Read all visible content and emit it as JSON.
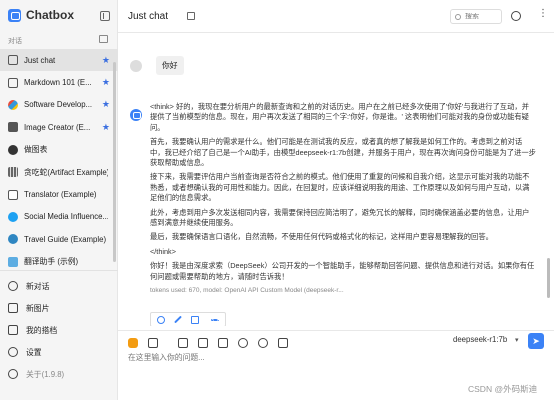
{
  "app": {
    "name": "Chatbox",
    "version_label": "关于(1.9.8)"
  },
  "sidebar": {
    "section_label": "对话",
    "items": [
      {
        "label": "Just chat",
        "icon": "chat-icon",
        "active": true,
        "starred": true
      },
      {
        "label": "Markdown 101 (E...",
        "icon": "chat-icon",
        "starred": true
      },
      {
        "label": "Software Develop...",
        "icon": "developer-avatar",
        "starred": true
      },
      {
        "label": "Image Creator (E...",
        "icon": "image-icon",
        "starred": true
      },
      {
        "label": "做图表",
        "icon": "chart-avatar",
        "starred": false
      },
      {
        "label": "贪吃蛇(Artifact Example)",
        "icon": "grid-avatar",
        "starred": false
      },
      {
        "label": "Translator (Example)",
        "icon": "translate-icon",
        "starred": false
      },
      {
        "label": "Social Media Influence...",
        "icon": "twitter-icon",
        "starred": false
      },
      {
        "label": "Travel Guide (Example)",
        "icon": "globe-avatar",
        "starred": false
      },
      {
        "label": "翻译助手 (示例)",
        "icon": "translate-avatar",
        "starred": false
      }
    ],
    "bottom": {
      "new_chat": "新对话",
      "new_image": "新图片",
      "my_partners": "我的搭档",
      "settings": "设置"
    }
  },
  "header": {
    "title": "Just chat",
    "search_placeholder": "搜索"
  },
  "conversation": {
    "user_message": "你好",
    "bot_paragraphs": [
      "<think> 好的，我现在要分析用户的最新查询和之前的对话历史。用户在之前已经多次使用了'你好'与我进行了互动，并提供了当前模型的信息。现在，用户再次发送了相同的三个字:'你好，你是谁。' 这表明他们可能对我的身份或功能有疑问。",
      "首先，我要确认用户的需求是什么。他们可能是在测试我的反应，或者真的想了解我是如何工作的。考虑到之前对话中，我已经介绍了自己是一个AI助手，由模型deepseek-r1:7b创建，并服务于用户，现在再次询问身份可能是为了进一步获取帮助或信息。",
      "接下来，我需要评估用户当前查询是否符合之前的模式。他们使用了重复的问候和自我介绍，这显示可能对我的功能不熟悉，或者想确认我的可用性和能力。因此，在回复时，应该详细说明我的用途、工作原理以及如何与用户互动，以满足他们的信息需求。",
      "此外，考虑到用户多次发送相同内容，我需要保持回应简洁明了，避免冗长的解释，同时确保涵盖必要的信息，让用户感到满意并继续使用服务。",
      "最后，我要确保语言口语化，自然流畅，不使用任何代码或格式化的标记，这样用户更容易理解我的回答。",
      "</think>",
      "你好！我是由深度求索（DeepSeek）公司开发的一个智能助手，能够帮助回答问题、提供信息和进行对话。如果你有任何问题或需要帮助的地方，请随时告诉我！"
    ],
    "meta": "tokens used: 670, model: OpenAI API Custom Model (deepseek-r..."
  },
  "composer": {
    "model": "deepseek-r1:7b",
    "placeholder": "在这里输入你的问题..."
  },
  "watermark": "CSDN @外码斯迪"
}
